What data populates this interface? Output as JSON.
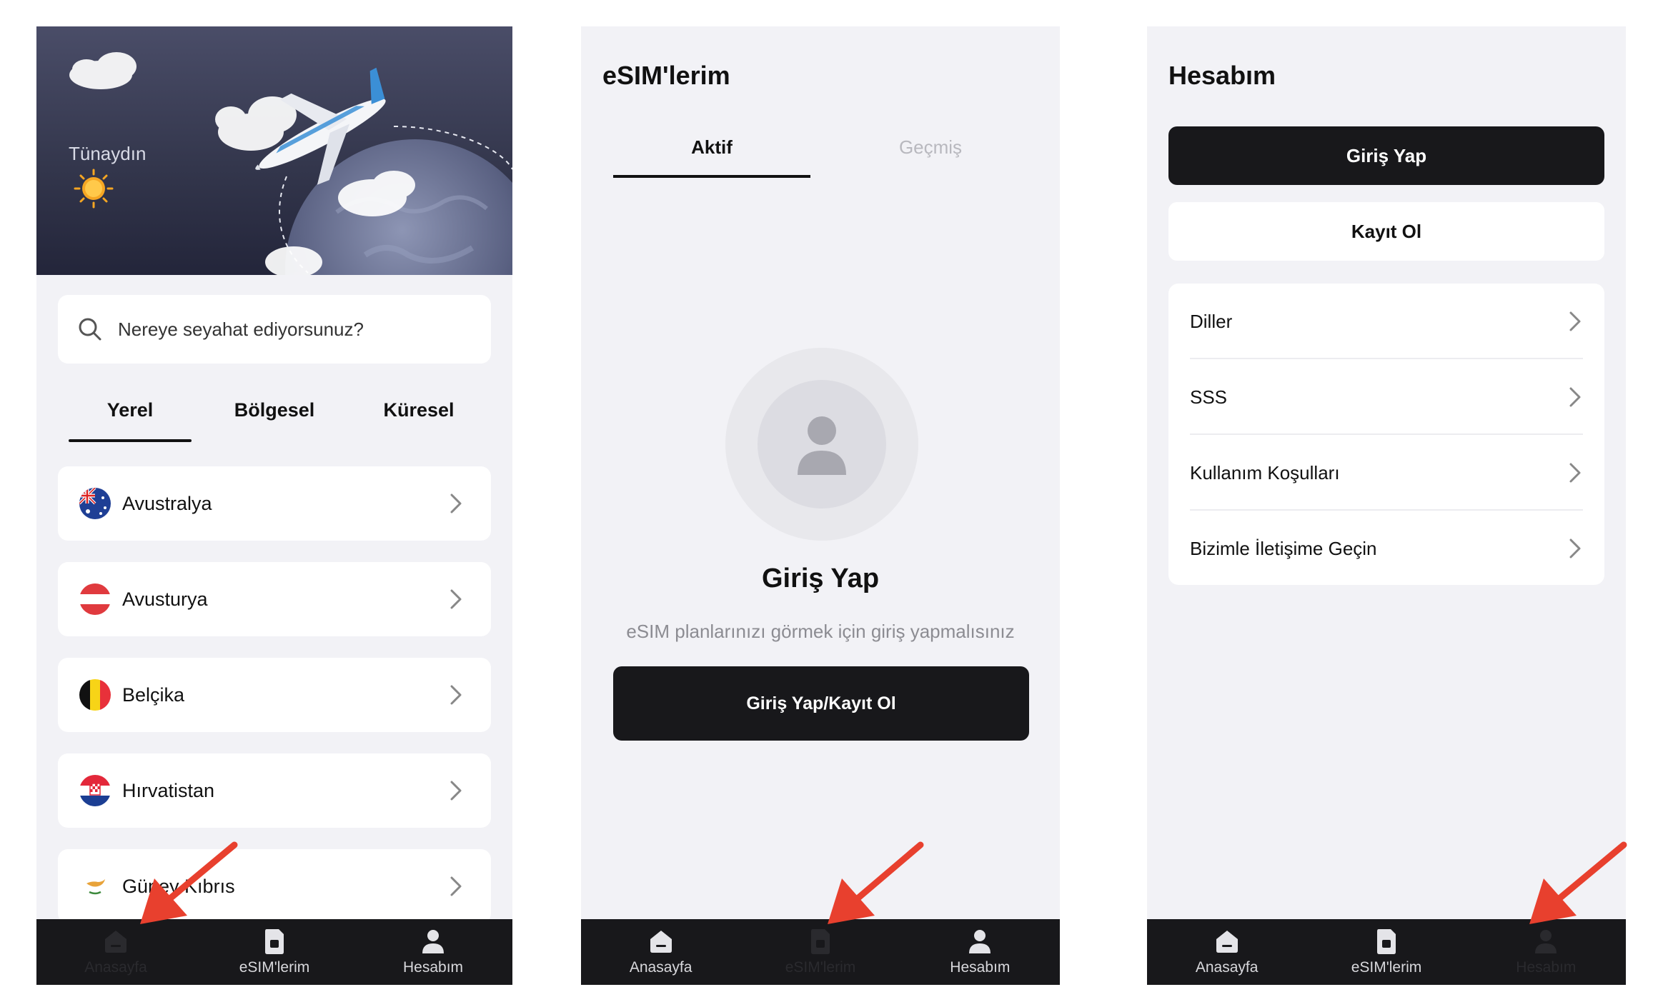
{
  "home": {
    "greeting": "Tünaydın",
    "search": {
      "placeholder": "Nereye seyahat ediyorsunuz?"
    },
    "tabs": [
      "Yerel",
      "Bölgesel",
      "Küresel"
    ],
    "countries": [
      "Avustralya",
      "Avusturya",
      "Belçika",
      "Hırvatistan",
      "Güney Kıbrıs"
    ]
  },
  "esims": {
    "title": "eSIM'lerim",
    "tabs": [
      "Aktif",
      "Geçmiş"
    ],
    "empty_title": "Giriş Yap",
    "empty_subtitle": "eSIM planlarınızı görmek için giriş yapmalısınız",
    "cta": "Giriş Yap/Kayıt Ol"
  },
  "account": {
    "title": "Hesabım",
    "login": "Giriş Yap",
    "register": "Kayıt Ol",
    "menu": [
      "Diller",
      "SSS",
      "Kullanım Koşulları",
      "Bizimle İletişime Geçin"
    ]
  },
  "tabbar": [
    "Anasayfa",
    "eSIM'lerim",
    "Hesabım"
  ],
  "colors": {
    "dark": "#18181b",
    "background": "#f2f2f6",
    "arrow": "#e8402e"
  }
}
